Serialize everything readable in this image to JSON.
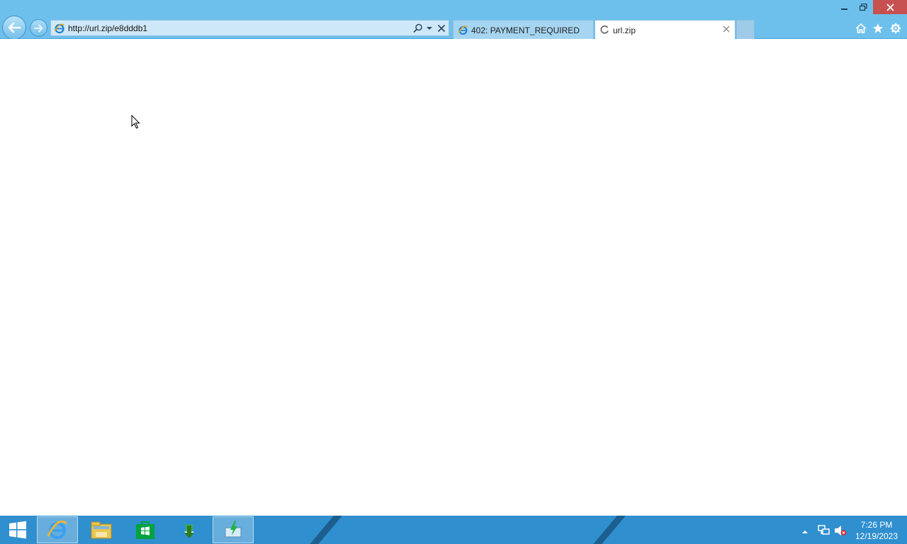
{
  "browser": {
    "address_bar": {
      "url": "http://url.zip/e8dddb1"
    },
    "tabs": [
      {
        "title": "402: PAYMENT_REQUIRED",
        "active": false,
        "icon": "ie-page-icon"
      },
      {
        "title": "url.zip",
        "active": true,
        "icon": "loading-icon"
      }
    ],
    "toolbar_icons": [
      "home-icon",
      "favorites-star-icon",
      "tools-gear-icon"
    ],
    "window_controls": [
      "minimize-icon",
      "restore-icon",
      "close-icon"
    ]
  },
  "page": {
    "content": ""
  },
  "taskbar": {
    "start_icon": "windows-logo-icon",
    "pinned": [
      {
        "name": "internet-explorer",
        "active": true
      },
      {
        "name": "file-explorer",
        "active": false
      },
      {
        "name": "windows-store",
        "active": false
      },
      {
        "name": "internet-download-manager",
        "active": false
      },
      {
        "name": "download-app",
        "active": true
      }
    ],
    "tray": {
      "icons": [
        "show-hidden-icons",
        "network-icon",
        "volume-muted-icon"
      ],
      "time": "7:26 PM",
      "date": "12/19/2023"
    }
  },
  "colors": {
    "chrome": "#6ec0ec",
    "taskbar": "#2f8fcf",
    "close_button": "#c75050"
  }
}
